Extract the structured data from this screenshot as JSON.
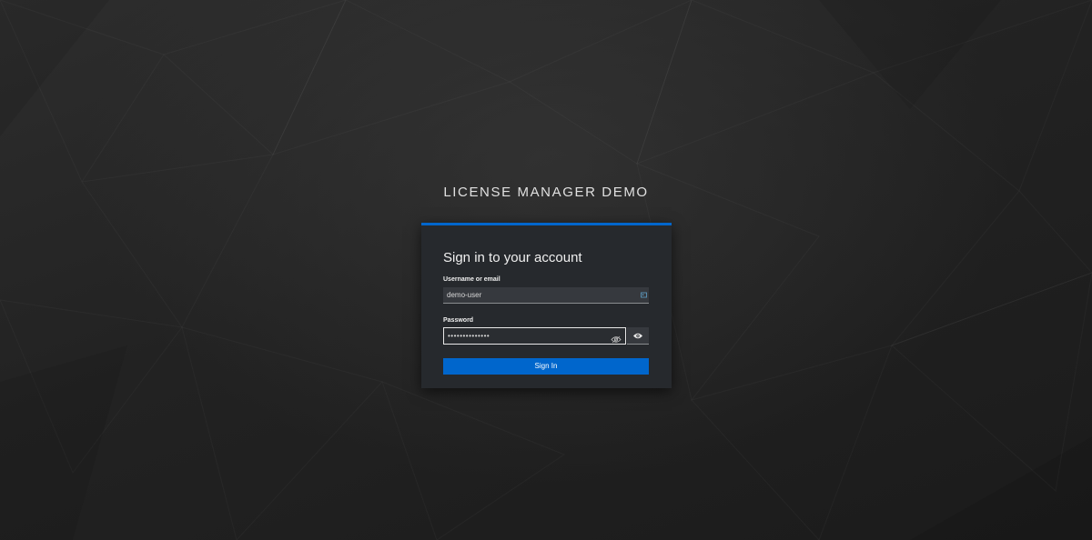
{
  "brand": "LICENSE MANAGER DEMO",
  "login": {
    "title": "Sign in to your account",
    "username_label": "Username or email",
    "username_value": "demo-user",
    "password_label": "Password",
    "password_masked": "••••••••••••••",
    "submit_label": "Sign In"
  },
  "colors": {
    "accent": "#0066cc",
    "card_bg": "#26292d",
    "page_bg": "#1e1e1e"
  },
  "icons": {
    "username_field": "user-card-icon",
    "password_inner": "eye-icon",
    "password_toggle": "eye-icon"
  }
}
